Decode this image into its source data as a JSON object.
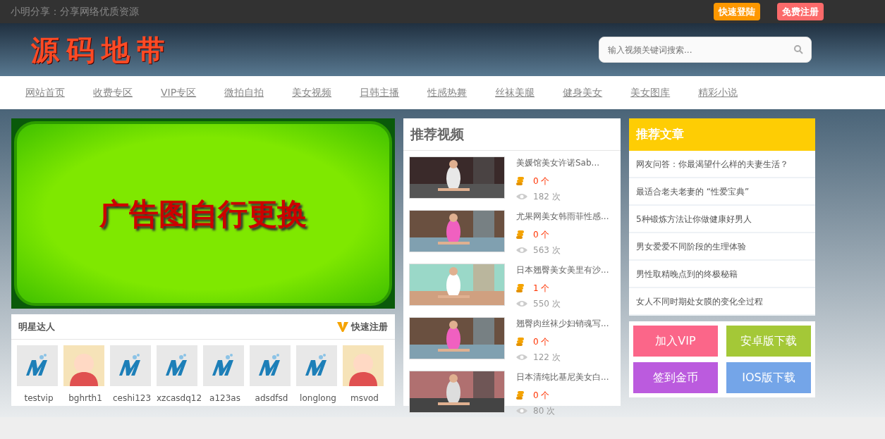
{
  "topbar": {
    "tagline": "小明分享：分享网络优质资源",
    "buttons": [
      {
        "label": "快速登陆",
        "kind": "login"
      },
      {
        "label": "免费注册",
        "kind": "register"
      }
    ]
  },
  "header": {
    "logo": "源码地带",
    "search": {
      "placeholder": "输入视频关键词搜索..."
    }
  },
  "nav": [
    "网站首页",
    "收费专区",
    "VIP专区",
    "微拍自拍",
    "美女视频",
    "日韩主播",
    "性感热舞",
    "丝袜美腿",
    "健身美女",
    "美女图库",
    "精彩小说"
  ],
  "ad_banner": {
    "text": "广告图自行更换"
  },
  "stars": {
    "title": "明星达人",
    "register_link": "快速注册",
    "members": [
      {
        "name": "testvip",
        "kind": "logo"
      },
      {
        "name": "bghrth1",
        "kind": "cartoon"
      },
      {
        "name": "ceshi123",
        "kind": "logo"
      },
      {
        "name": "xzcasdq12",
        "kind": "logo"
      },
      {
        "name": "a123as",
        "kind": "logo"
      },
      {
        "name": "adsdfsd",
        "kind": "logo"
      },
      {
        "name": "longlong",
        "kind": "logo"
      },
      {
        "name": "msvod",
        "kind": "cartoon"
      }
    ]
  },
  "videos": {
    "title": "推荐视频",
    "items": [
      {
        "title": "美媛馆美女许诺Sab...",
        "coins": "0 个",
        "views": "182 次"
      },
      {
        "title": "尤果网美女韩雨菲性感...",
        "coins": "0 个",
        "views": "563 次"
      },
      {
        "title": "日本翘臀美女美里有沙...",
        "coins": "1 个",
        "views": "550 次"
      },
      {
        "title": "翘臀肉丝袜少妇销魂写...",
        "coins": "0 个",
        "views": "122 次"
      },
      {
        "title": "日本清纯比基尼美女白...",
        "coins": "0 个",
        "views": "80 次"
      }
    ]
  },
  "articles": {
    "title": "推荐文章",
    "items": [
      "网友问答：你最渴望什么样的夫妻生活？",
      "最适合老夫老妻的 “性爱宝典”",
      "5种锻炼方法让你做健康好男人",
      "男女爱爱不同阶段的生理体验",
      "男性取精晚点到的终极秘籍",
      "女人不同时期处女膜的变化全过程"
    ]
  },
  "actions": [
    {
      "label": "加入VIP",
      "color": "#fb6689"
    },
    {
      "label": "安卓版下载",
      "color": "#a4c837"
    },
    {
      "label": "签到金币",
      "color": "#bb5bde"
    },
    {
      "label": "IOS版下载",
      "color": "#74a5e8"
    }
  ]
}
